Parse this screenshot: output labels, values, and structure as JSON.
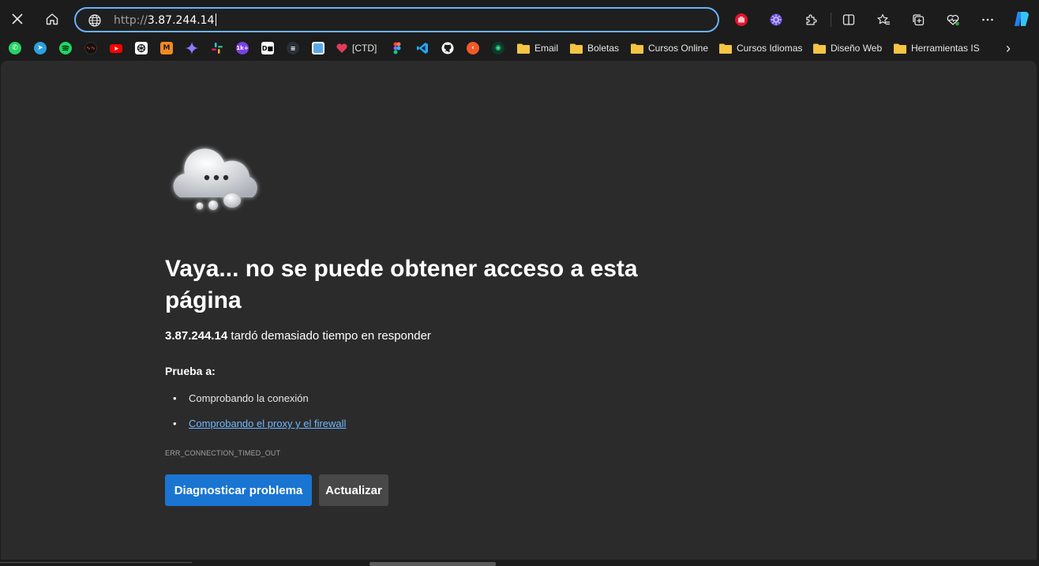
{
  "toolbar": {
    "address": {
      "scheme": "http://",
      "host": "3.87.244.14"
    },
    "icons": [
      "close-icon",
      "home-icon",
      "globe-icon",
      "extension-hand-icon",
      "extension-gear-icon",
      "puzzle-icon",
      "split-screen-icon",
      "favorites-icon",
      "collections-icon",
      "performance-icon",
      "more-icon",
      "copilot-icon"
    ]
  },
  "bookmarks": {
    "ctd_label": "[CTD]",
    "folders": [
      "Email",
      "Boletas",
      "Cursos Online",
      "Cursos Idiomas",
      "Diseño Web",
      "Herramientas IS"
    ],
    "overflow": "›"
  },
  "error": {
    "title": "Vaya... no se puede obtener acceso a esta página",
    "host": "3.87.244.14",
    "subtitle_rest": " tardó demasiado tiempo en responder",
    "try_label": "Prueba a:",
    "suggestions": [
      "Comprobando la conexión",
      "Comprobando el proxy y el firewall"
    ],
    "bullet": "•",
    "code": "ERR_CONNECTION_TIMED_OUT",
    "primary_button": "Diagnosticar problema",
    "secondary_button": "Actualizar"
  },
  "colors": {
    "accent": "#1a75d2",
    "link": "#6fb8ff",
    "address_border": "#6bb1ff",
    "page_bg": "#2b2b2b",
    "chrome_bg": "#1c1c1c"
  }
}
